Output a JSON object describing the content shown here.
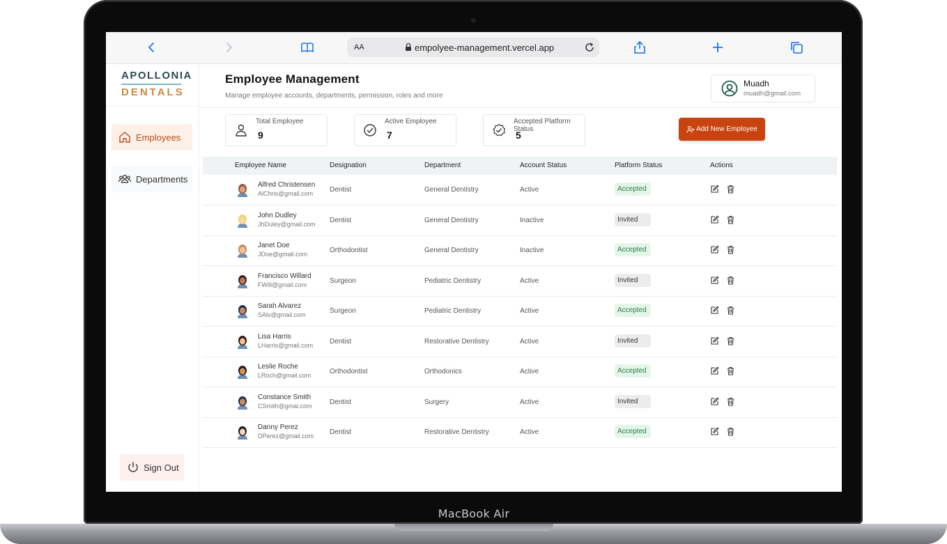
{
  "device": {
    "label": "MacBook Air"
  },
  "browser": {
    "text_size_label": "AA",
    "url": "empolyee-management.vercel.app"
  },
  "sidebar": {
    "logo_top": "APOLLONIA",
    "logo_bottom": "DENTALS",
    "items": [
      {
        "label": "Employees",
        "icon": "home-icon",
        "active": true
      },
      {
        "label": "Departments",
        "icon": "users-group-icon",
        "active": false
      }
    ],
    "signout_label": "Sign Out"
  },
  "header": {
    "title": "Employee Management",
    "subtitle": "Manage employee accounts, departments, permission, roles and more"
  },
  "user": {
    "name": "Muadh",
    "email": "muadh@gmail.com"
  },
  "stats": [
    {
      "label": "Total Employee",
      "value": "9",
      "icon": "person-icon"
    },
    {
      "label": "Active Employee",
      "value": "7",
      "icon": "check-circle-icon"
    },
    {
      "label": "Accepted Platform Status",
      "value": "5",
      "icon": "badge-check-icon"
    }
  ],
  "add_button_label": "Add New Employee",
  "table": {
    "columns": [
      "Employee Name",
      "Designation",
      "Department",
      "Account Status",
      "Platform Status",
      "Actions"
    ],
    "rows": [
      {
        "name": "Alfred Christensen",
        "email": "AlChris@gmail.com",
        "designation": "Dentist",
        "department": "General Dentistry",
        "account_status": "Active",
        "platform_status": "Accepted"
      },
      {
        "name": "John Dudley",
        "email": "JhDuley@gmail.com",
        "designation": "Dentist",
        "department": "General Dentistry",
        "account_status": "Inactive",
        "platform_status": "Invited"
      },
      {
        "name": "Janet Doe",
        "email": "JDoe@gmail.com",
        "designation": "Orthodontist",
        "department": "General Dentistry",
        "account_status": "Inactive",
        "platform_status": "Accepted"
      },
      {
        "name": "Francisco Willard",
        "email": "FWill@gmail.com",
        "designation": "Surgeon",
        "department": "Pediatric Dentistry",
        "account_status": "Active",
        "platform_status": "Invited"
      },
      {
        "name": "Sarah Alvarez",
        "email": "SAlv@gmail.com",
        "designation": "Surgeon",
        "department": "Pediatric Dentistry",
        "account_status": "Active",
        "platform_status": "Accepted"
      },
      {
        "name": "Lisa Harris",
        "email": "LHarris@gmail.com",
        "designation": "Dentist",
        "department": "Restorative Dentistry",
        "account_status": "Active",
        "platform_status": "Invited"
      },
      {
        "name": "Leslie Roche",
        "email": "LRoch@gmail.com",
        "designation": "Orthodontist",
        "department": "Orthodonics",
        "account_status": "Active",
        "platform_status": "Accepted"
      },
      {
        "name": "Constance Smith",
        "email": "CSmith@gmai.com",
        "designation": "Dentist",
        "department": "Surgery",
        "account_status": "Active",
        "platform_status": "Invited"
      },
      {
        "name": "Danny Perez",
        "email": "DPerez@gmail.com",
        "designation": "Dentist",
        "department": "Restorative Dentistry",
        "account_status": "Active",
        "platform_status": "Accepted"
      }
    ]
  },
  "colors": {
    "accent": "#c9430e",
    "accepted_bg": "#e4f6ea",
    "invited_bg": "#ececee",
    "browser_blue": "#1a73e8"
  }
}
